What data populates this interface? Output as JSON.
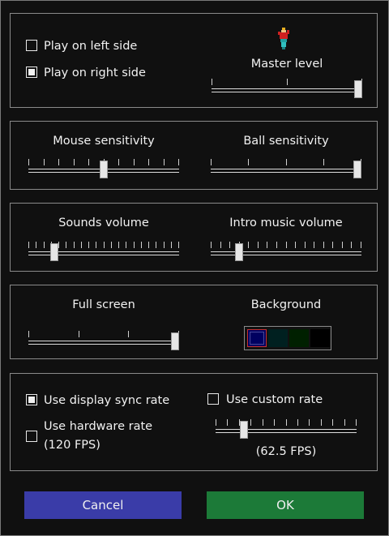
{
  "side_panel": {
    "play_left": {
      "label": "Play on left side",
      "checked": false
    },
    "play_right": {
      "label": "Play on right side",
      "checked": true
    },
    "master_level": {
      "label": "Master level",
      "value": 1.0
    }
  },
  "sensitivity_panel": {
    "mouse": {
      "label": "Mouse sensitivity",
      "value": 0.5
    },
    "ball": {
      "label": "Ball sensitivity",
      "value": 1.0
    }
  },
  "volume_panel": {
    "sounds": {
      "label": "Sounds volume",
      "value": 0.17
    },
    "intro": {
      "label": "Intro music volume",
      "value": 0.19
    }
  },
  "display_panel": {
    "fullscreen": {
      "label": "Full screen",
      "value": 1.0
    },
    "background": {
      "label": "Background",
      "selected_index": 0,
      "colors": [
        "#000060",
        "#002020",
        "#002000",
        "#000000"
      ]
    }
  },
  "rate_panel": {
    "display_sync": {
      "label": "Use display sync rate",
      "checked": true
    },
    "hardware": {
      "label": "Use hardware rate",
      "sub": "(120 FPS)",
      "checked": false
    },
    "custom": {
      "label": "Use custom rate",
      "checked": false,
      "value": 0.2,
      "readout": "(62.5 FPS)"
    }
  },
  "buttons": {
    "cancel": {
      "label": "Cancel",
      "color": "#3a3ca8"
    },
    "ok": {
      "label": "OK",
      "color": "#1c7a38"
    }
  }
}
